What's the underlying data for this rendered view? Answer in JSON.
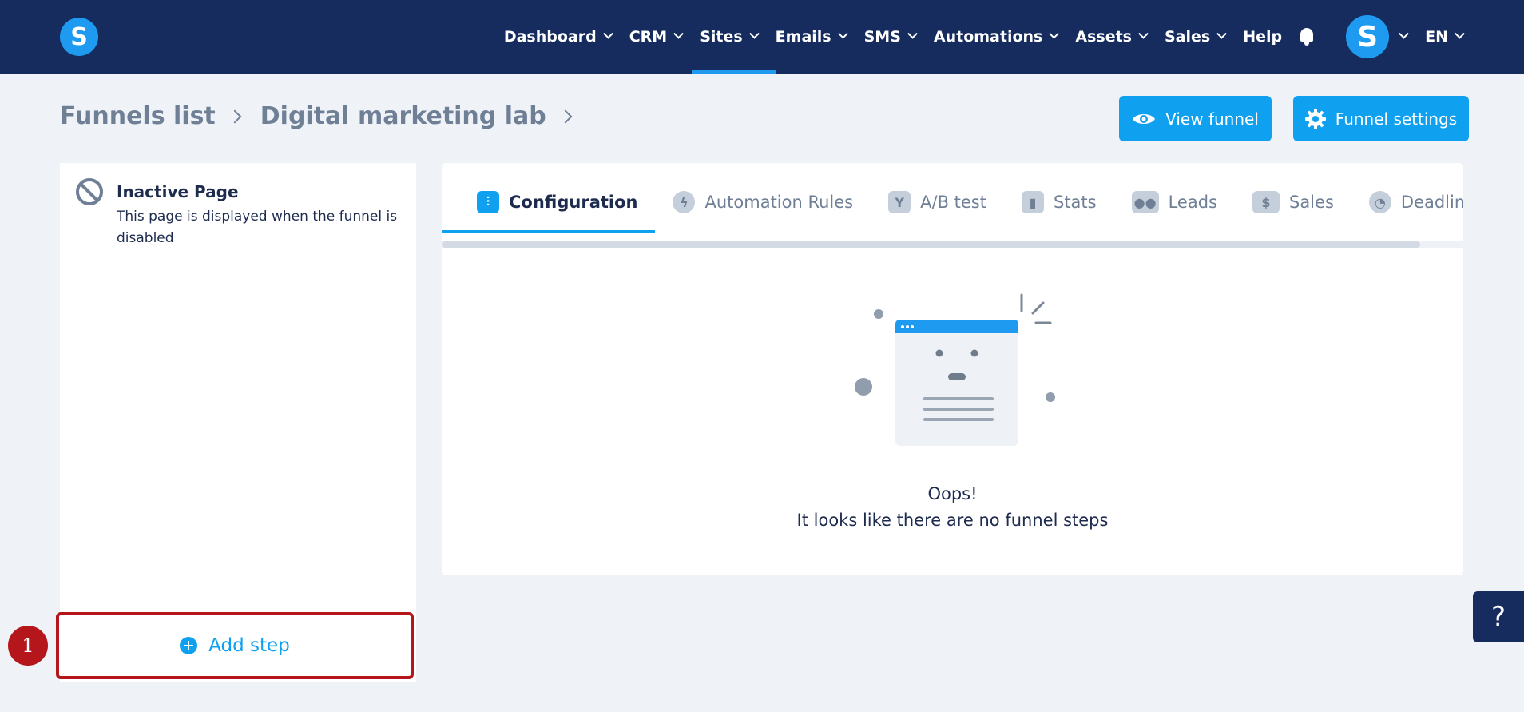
{
  "brand": {
    "logo_letter": "S"
  },
  "nav": {
    "items": [
      {
        "label": "Dashboard",
        "dropdown": true
      },
      {
        "label": "CRM",
        "dropdown": true
      },
      {
        "label": "Sites",
        "dropdown": true,
        "active": true
      },
      {
        "label": "Emails",
        "dropdown": true
      },
      {
        "label": "SMS",
        "dropdown": true
      },
      {
        "label": "Automations",
        "dropdown": true
      },
      {
        "label": "Assets",
        "dropdown": true
      },
      {
        "label": "Sales",
        "dropdown": true
      },
      {
        "label": "Help",
        "dropdown": false
      }
    ],
    "avatar_letter": "S",
    "language": "EN"
  },
  "breadcrumb": {
    "root": "Funnels list",
    "current": "Digital marketing lab"
  },
  "actions": {
    "view_funnel": "View funnel",
    "funnel_settings": "Funnel settings"
  },
  "sidebar": {
    "inactive_title": "Inactive Page",
    "inactive_desc": "This page is displayed when the funnel is disabled",
    "add_step": "Add step",
    "marker": "1"
  },
  "tabs": [
    {
      "label": "Configuration",
      "icon": "sliders-icon",
      "active": true
    },
    {
      "label": "Automation Rules",
      "icon": "lightning-icon"
    },
    {
      "label": "A/B test",
      "icon": "split-icon"
    },
    {
      "label": "Stats",
      "icon": "bar-chart-icon"
    },
    {
      "label": "Leads",
      "icon": "people-icon"
    },
    {
      "label": "Sales",
      "icon": "dollar-icon"
    },
    {
      "label": "Deadline setti",
      "icon": "clock-icon"
    }
  ],
  "empty_state": {
    "title": "Oops!",
    "message": "It looks like there are no funnel steps"
  },
  "help_fab": "?",
  "colors": {
    "topbar": "#162c5e",
    "accent": "#0fa0f0",
    "highlight": "#b4161b",
    "background": "#eff3f8"
  }
}
